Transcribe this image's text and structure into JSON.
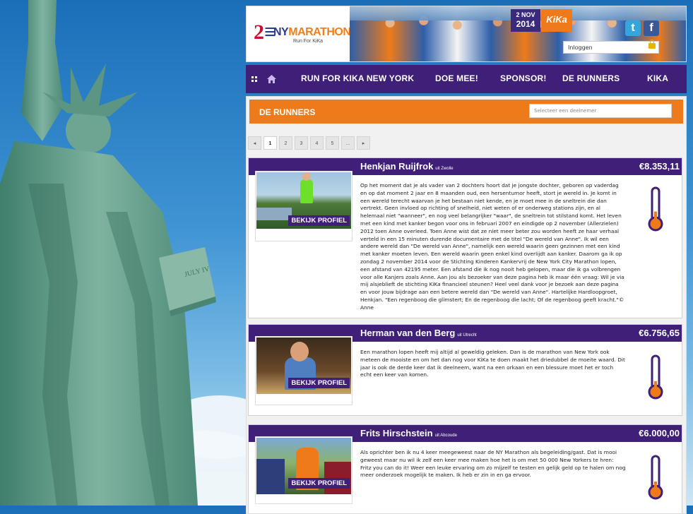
{
  "header": {
    "logo_title": "NYMARATHON",
    "logo_title_prefix": "NY",
    "logo_title_suffix": "MARATHON",
    "logo_subtitle": "Run For KiKa",
    "date_line1": "2 NOV",
    "date_line2": "2014",
    "kika_badge": "KiKa",
    "twitter_icon": "t",
    "facebook_icon": "f",
    "login_label": "Inloggen"
  },
  "nav": {
    "items": [
      {
        "label": "RUN FOR KIKA NEW YORK"
      },
      {
        "label": "DOE MEE!"
      },
      {
        "label": "SPONSOR!"
      },
      {
        "label": "DE RUNNERS"
      },
      {
        "label": "KIKA"
      }
    ]
  },
  "section": {
    "title": "DE RUNNERS",
    "select_placeholder": "Selecteer een deelnemer"
  },
  "pager": {
    "prev": "◂",
    "pages": [
      "1",
      "2",
      "3",
      "4",
      "5",
      "..."
    ],
    "next": "▸",
    "current": "1"
  },
  "colors": {
    "accent_orange": "#ef7a1a",
    "brand_purple": "#3f1f78"
  },
  "runners": [
    {
      "name": "Henkjan Ruijfrok",
      "origin": "uit Zwolle",
      "amount": "€8.353,11",
      "button": "BEKIJK PROFIEL",
      "description": "Op het moment dat je als vader van 2 dochters hoort dat je jongste dochter, geboren op vaderdag en op dat moment 2 jaar en 8 maanden oud, een hersentumor heeft, stort je wereld in. Je komt in een wereld terecht waarvan je het bestaan niet kende, en je moet mee in de sneltrein die dan vertrekt. Geen invloed op richting of snelheid, niet weten of er onderweg stations zijn, en al helemaal niet \"wanneer\", en nog veel belangrijker \"waar\", de sneltrein tot stilstand komt. Het leven met een kind met kanker begon voor ons in februari 2007 en eindigde op 2 november (Allerzielen) 2012 toen Anne overleed. Toen Anne wist dat ze niet meer beter zou worden heeft ze haar verhaal verteld in een 15 minuten durende documentaire met de titel \"De wereld van Anne\". Ik wil een andere wereld dan \"De wereld van Anne\", namelijk een wereld waarin geen gezinnen met een kind met kanker moeten leven. Een wereld waarin geen enkel kind overlijdt aan kanker. Daarom ga ik op zondag 2 november 2014 voor de Stichting Kinderen Kankervrij de New York City Marathon lopen, een afstand van 42195 meter. Een afstand die ik nog nooit heb gelopen, maar die ik ga volbrengen voor alle Kanjers zoals Anne. Aan jou als bezoeker van deze pagina heb ik maar één vraag: Wil je via mij alsjeblieft de stichting KiKa financieel steunen? Heel veel dank voor je bezoek aan deze pagina en voor jouw bijdrage aan een betere wereld dan \"De wereld van Anne\". Hartelijke Hardloopgroet, Henkjan. \"Een regenboog die glimstert; En de regenboog die lacht; Of de regenboog geeft kracht.\"© Anne",
      "fill": 0.3
    },
    {
      "name": "Herman van den Berg",
      "origin": "uit Utrecht",
      "amount": "€6.756,65",
      "button": "BEKIJK PROFIEL",
      "description": "Een marathon lopen heeft mij altijd al geweldig geleken. Dan is de marathon van New York ook meteen de mooiste en om het dan nog voor KiKa te doen maakt het driedubbel de moeite waard. Dit jaar is ook de derde keer dat ik deelneem, want na een orkaan en een blessure moet het er toch echt een keer van komen.",
      "fill": 0.25
    },
    {
      "name": "Frits Hirschstein",
      "origin": "uit Abcoude",
      "amount": "€6.000,00",
      "button": "BEKIJK PROFIEL",
      "description": "Als oprichter ben ik nu 4 keer meegeweest naar de NY Marathon als begeleiding/gast. Dat is mooi geweest maar nu wil ik zelf een keer mee maken hoe het is om met 50 000 New Yorkers te hren: Fritz you can do it! Weer een leuke ervaring om zo mijzelf te testen en gelijk geld op te halen om nog meer onderzoek mogelijk te maken. Ik heb er zin in en ga ervoor.",
      "fill": 0.25
    }
  ]
}
